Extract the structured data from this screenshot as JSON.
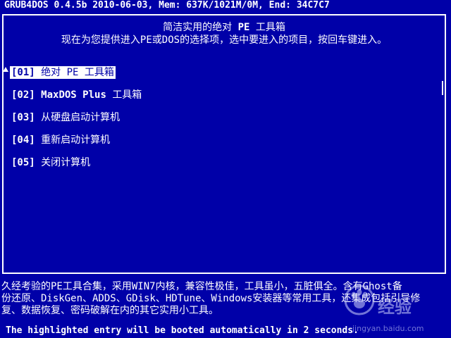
{
  "header": {
    "status_line": "GRUB4DOS 0.4.5b 2010-06-03, Mem: 637K/1021M/0M, End: 34C7C7"
  },
  "menu": {
    "title_line1_pre": "简洁实用的绝对 ",
    "title_line1_latin": "PE",
    "title_line1_post": " 工具箱",
    "title_line2": "现在为您提供进入PE或DOS的选择项，选中要进入的项目，按回车键进入。",
    "items": [
      {
        "num": "[01]",
        "label_latin": "",
        "label": "绝对 PE 工具箱"
      },
      {
        "num": "[02]",
        "label_latin": "MaxDOS Plus",
        "label": "工具箱"
      },
      {
        "num": "[03]",
        "label_latin": "",
        "label": "从硬盘启动计算机"
      },
      {
        "num": "[04]",
        "label_latin": "",
        "label": "重新启动计算机"
      },
      {
        "num": "[05]",
        "label_latin": "",
        "label": "关闭计算机"
      }
    ],
    "selected_index": 0
  },
  "description": {
    "line1": " 久经考验的PE工具合集，采用WIN7内核，兼容性极佳，工具虽小，五脏俱全。含有Ghost备",
    "line2": "份还原、DiskGen、ADDS、GDisk、HDTune、Windows安装器等常用工具，还集成包括引导修",
    "line3": "复、数据恢复、密码破解在内的其它实用小工具。"
  },
  "footer": {
    "countdown_text": "The highlighted entry will be booted automatically in 2 seconds."
  },
  "watermark": {
    "brand": "经验",
    "url": "jingyan.baidu.com"
  },
  "colors": {
    "background": "#0000a8",
    "foreground": "#ffffff"
  }
}
